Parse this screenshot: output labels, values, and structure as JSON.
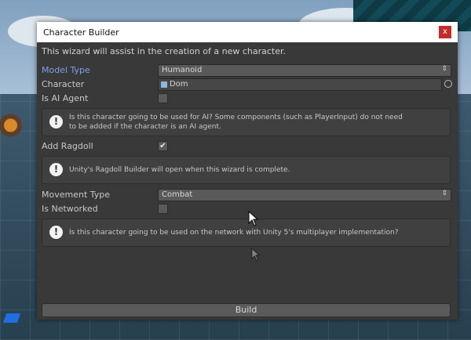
{
  "window": {
    "title": "Character Builder",
    "close_label": "x"
  },
  "intro": "This wizard will assist in the creation of a new character.",
  "fields": {
    "model_type": {
      "label": "Model Type",
      "value": "Humanoid"
    },
    "character": {
      "label": "Character",
      "value": "Dom"
    },
    "is_ai_agent": {
      "label": "Is AI Agent",
      "checked": false
    },
    "add_ragdoll": {
      "label": "Add Ragdoll",
      "checked": true,
      "check_glyph": "✔"
    },
    "movement_type": {
      "label": "Movement Type",
      "value": "Combat"
    },
    "is_networked": {
      "label": "Is Networked",
      "checked": false
    }
  },
  "help": {
    "ai": {
      "line1": "Is this character going to be used for AI? Some components (such as PlayerInput) do not need",
      "line2": "to be added if the character is an AI agent."
    },
    "ragdoll": "Unity's Ragdoll Builder will open when this wizard is complete.",
    "network": "Is this character going to be used on the network with Unity 5's multiplayer implementation?"
  },
  "icons": {
    "info": "!",
    "dropdown_arrow": "⇕"
  },
  "build_label": "Build",
  "colors": {
    "accent_label": "#7f9fe6",
    "close_button": "#c42b2b"
  }
}
